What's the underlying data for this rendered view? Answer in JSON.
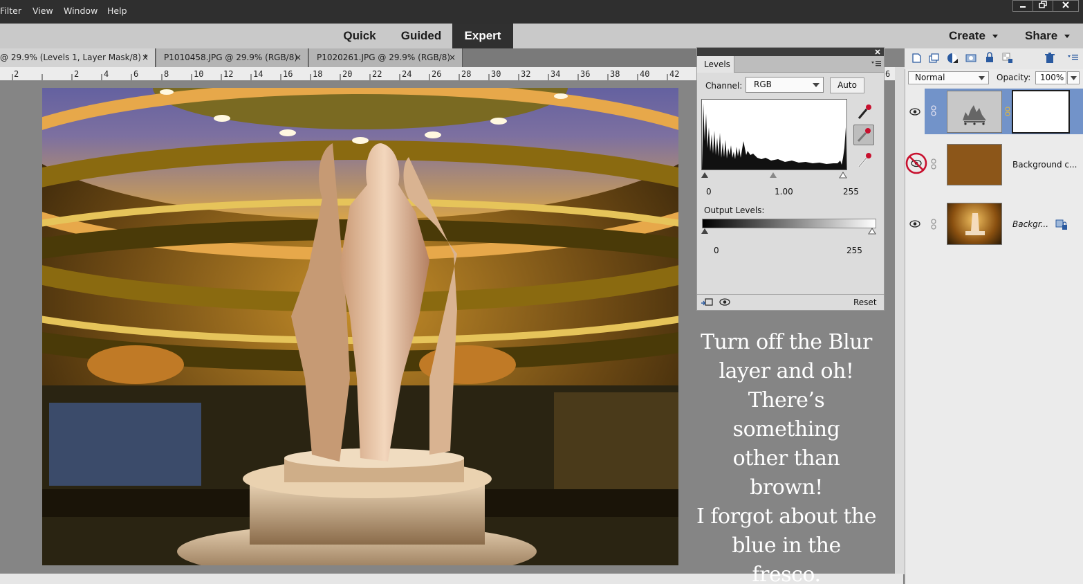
{
  "menubar": {
    "items": [
      "Filter",
      "View",
      "Window",
      "Help"
    ]
  },
  "modes": {
    "quick": "Quick",
    "guided": "Guided",
    "expert": "Expert",
    "create": "Create",
    "share": "Share"
  },
  "tabs": [
    {
      "label": "@ 29.9% (Levels 1, Layer Mask/8) *",
      "close": "×"
    },
    {
      "label": "P1010458.JPG @ 29.9% (RGB/8)",
      "close": "×"
    },
    {
      "label": "P1020261.JPG @ 29.9% (RGB/8)",
      "close": "×"
    }
  ],
  "ruler": {
    "labels": [
      "2",
      "2",
      "4",
      "6",
      "8",
      "10",
      "12",
      "14",
      "16",
      "18",
      "20",
      "22",
      "24",
      "26",
      "28",
      "30",
      "32",
      "34",
      "36",
      "38",
      "40",
      "42"
    ],
    "end_label": "6"
  },
  "levels": {
    "tab": "Levels",
    "channel_label": "Channel:",
    "channel_value": "RGB",
    "auto": "Auto",
    "input_black": "0",
    "input_gamma": "1.00",
    "input_white": "255",
    "output_label": "Output Levels:",
    "output_black": "0",
    "output_white": "255",
    "reset": "Reset"
  },
  "caption": [
    "Turn off the Blur",
    "layer and oh!",
    "There’s something",
    "other than brown!",
    "I forgot about the",
    "blue in the fresco."
  ],
  "layers": {
    "blend_mode": "Normal",
    "opacity_label": "Opacity:",
    "opacity_value": "100%",
    "items": [
      {
        "name": "",
        "visible": true
      },
      {
        "name": "Background c...",
        "visible": false
      },
      {
        "name": "Backgr...",
        "visible": true
      }
    ]
  },
  "colors": {
    "accent": "#7293c9",
    "fill_layer": "#8c5619",
    "hidden_icon": "#c8102e"
  }
}
